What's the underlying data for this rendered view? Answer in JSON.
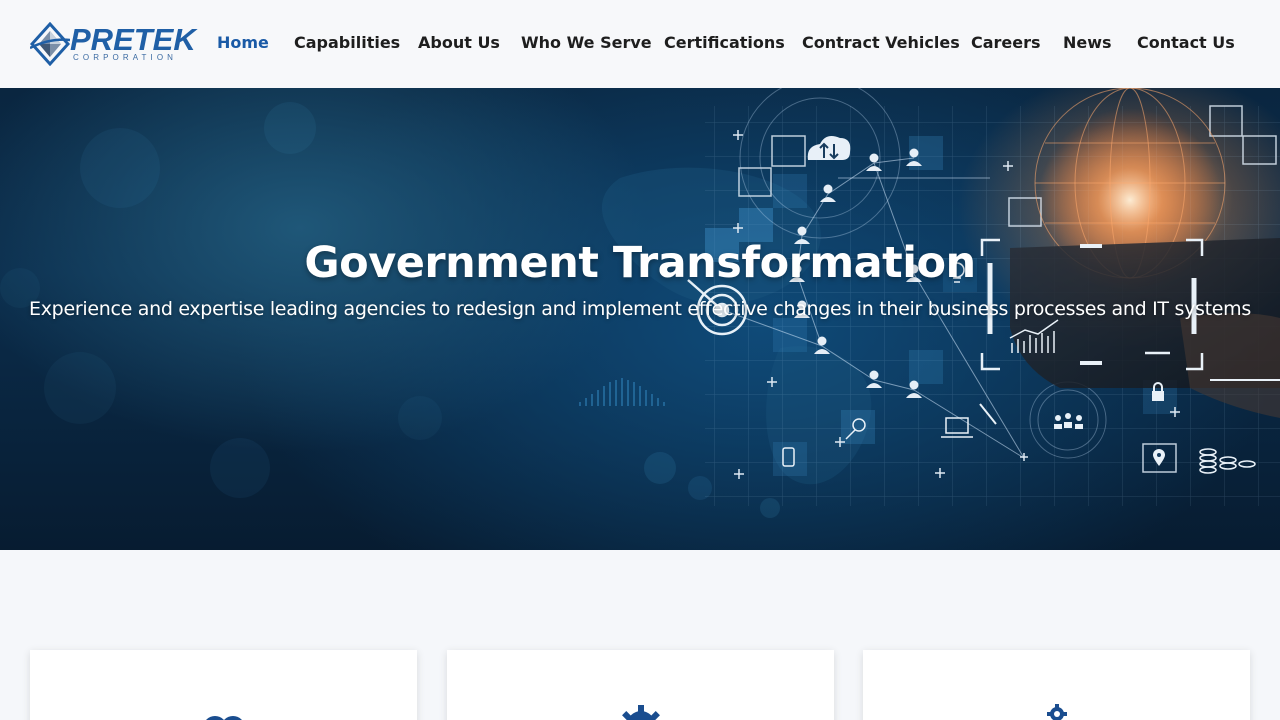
{
  "brand": {
    "name": "PRETEK",
    "sub": "CORPORATION"
  },
  "nav": {
    "items": [
      {
        "label": "Home",
        "active": true
      },
      {
        "label": "Capabilities"
      },
      {
        "label": "About Us"
      },
      {
        "label": "Who We Serve"
      },
      {
        "label": "Certifications"
      },
      {
        "label": "Contract Vehicles"
      },
      {
        "label": "Careers"
      },
      {
        "label": "News"
      },
      {
        "label": "Contact Us"
      }
    ]
  },
  "hero": {
    "title": "Government Transformation",
    "subtitle": "Experience and expertise leading agencies to redesign and implement effective changes in their business processes and IT systems"
  },
  "cards": [
    {
      "icon": "people-icon"
    },
    {
      "icon": "gear-icon"
    },
    {
      "icon": "gears-icon"
    }
  ],
  "colors": {
    "brand_blue": "#1a5aa6",
    "nav_text": "#1e1e1e",
    "hero_bg": "#0b2d4c",
    "page_bg": "#f5f7fa"
  }
}
